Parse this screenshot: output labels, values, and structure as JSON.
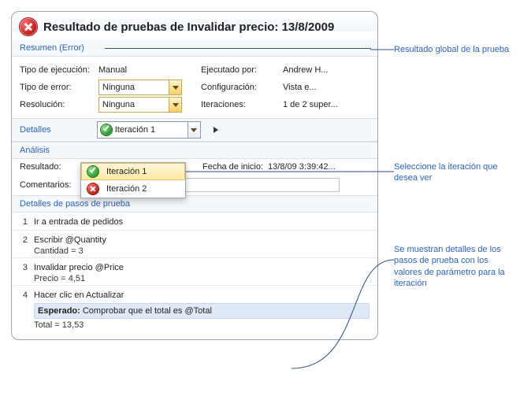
{
  "header": {
    "title": "Resultado de pruebas de Invalidar precio: 13/8/2009"
  },
  "summary": {
    "heading": "Resumen (Error)",
    "fields": {
      "runtype_label": "Tipo de ejecución:",
      "runtype_value": "Manual",
      "runby_label": "Ejecutado por:",
      "runby_value": "Andrew H...",
      "failtype_label": "Tipo de error:",
      "failtype_value": "Ninguna",
      "config_label": "Configuración:",
      "config_value": "Vista e...",
      "resolution_label": "Resolución:",
      "resolution_value": "Ninguna",
      "iterations_label": "Iteraciones:",
      "iterations_value": "1 de 2 super..."
    }
  },
  "details": {
    "heading": "Detalles",
    "iteration_selected": "Iteración 1",
    "options": [
      {
        "label": "Iteración 1",
        "status": "ok"
      },
      {
        "label": "Iteración 2",
        "status": "fail"
      }
    ]
  },
  "analysis": {
    "heading": "Análisis",
    "result_label": "Resultado:",
    "start_label": "Fecha de inicio:",
    "start_value": "13/8/09 3:39:42...",
    "comments_label": "Comentarios:",
    "comments_value": ""
  },
  "steps": {
    "heading": "Detalles de pasos de prueba",
    "items": [
      {
        "n": "1",
        "text": "Ir a entrada de pedidos"
      },
      {
        "n": "2",
        "text": "Escribir @Quantity",
        "sub": "Cantidad = 3"
      },
      {
        "n": "3",
        "text": "Invalidar precio @Price",
        "sub": "Precio = 4,51"
      },
      {
        "n": "4",
        "text": "Hacer clic en Actualizar",
        "expected_label": "Esperado:",
        "expected_text": "Comprobar que el total es @Total",
        "sub": "Total = 13,53"
      }
    ]
  },
  "callouts": {
    "c1": "Resultado global de la prueba",
    "c2": "Seleccione la iteración que desea ver",
    "c3": "Se muestran detalles de los pasos de prueba con los valores de parámetro para la iteración"
  }
}
